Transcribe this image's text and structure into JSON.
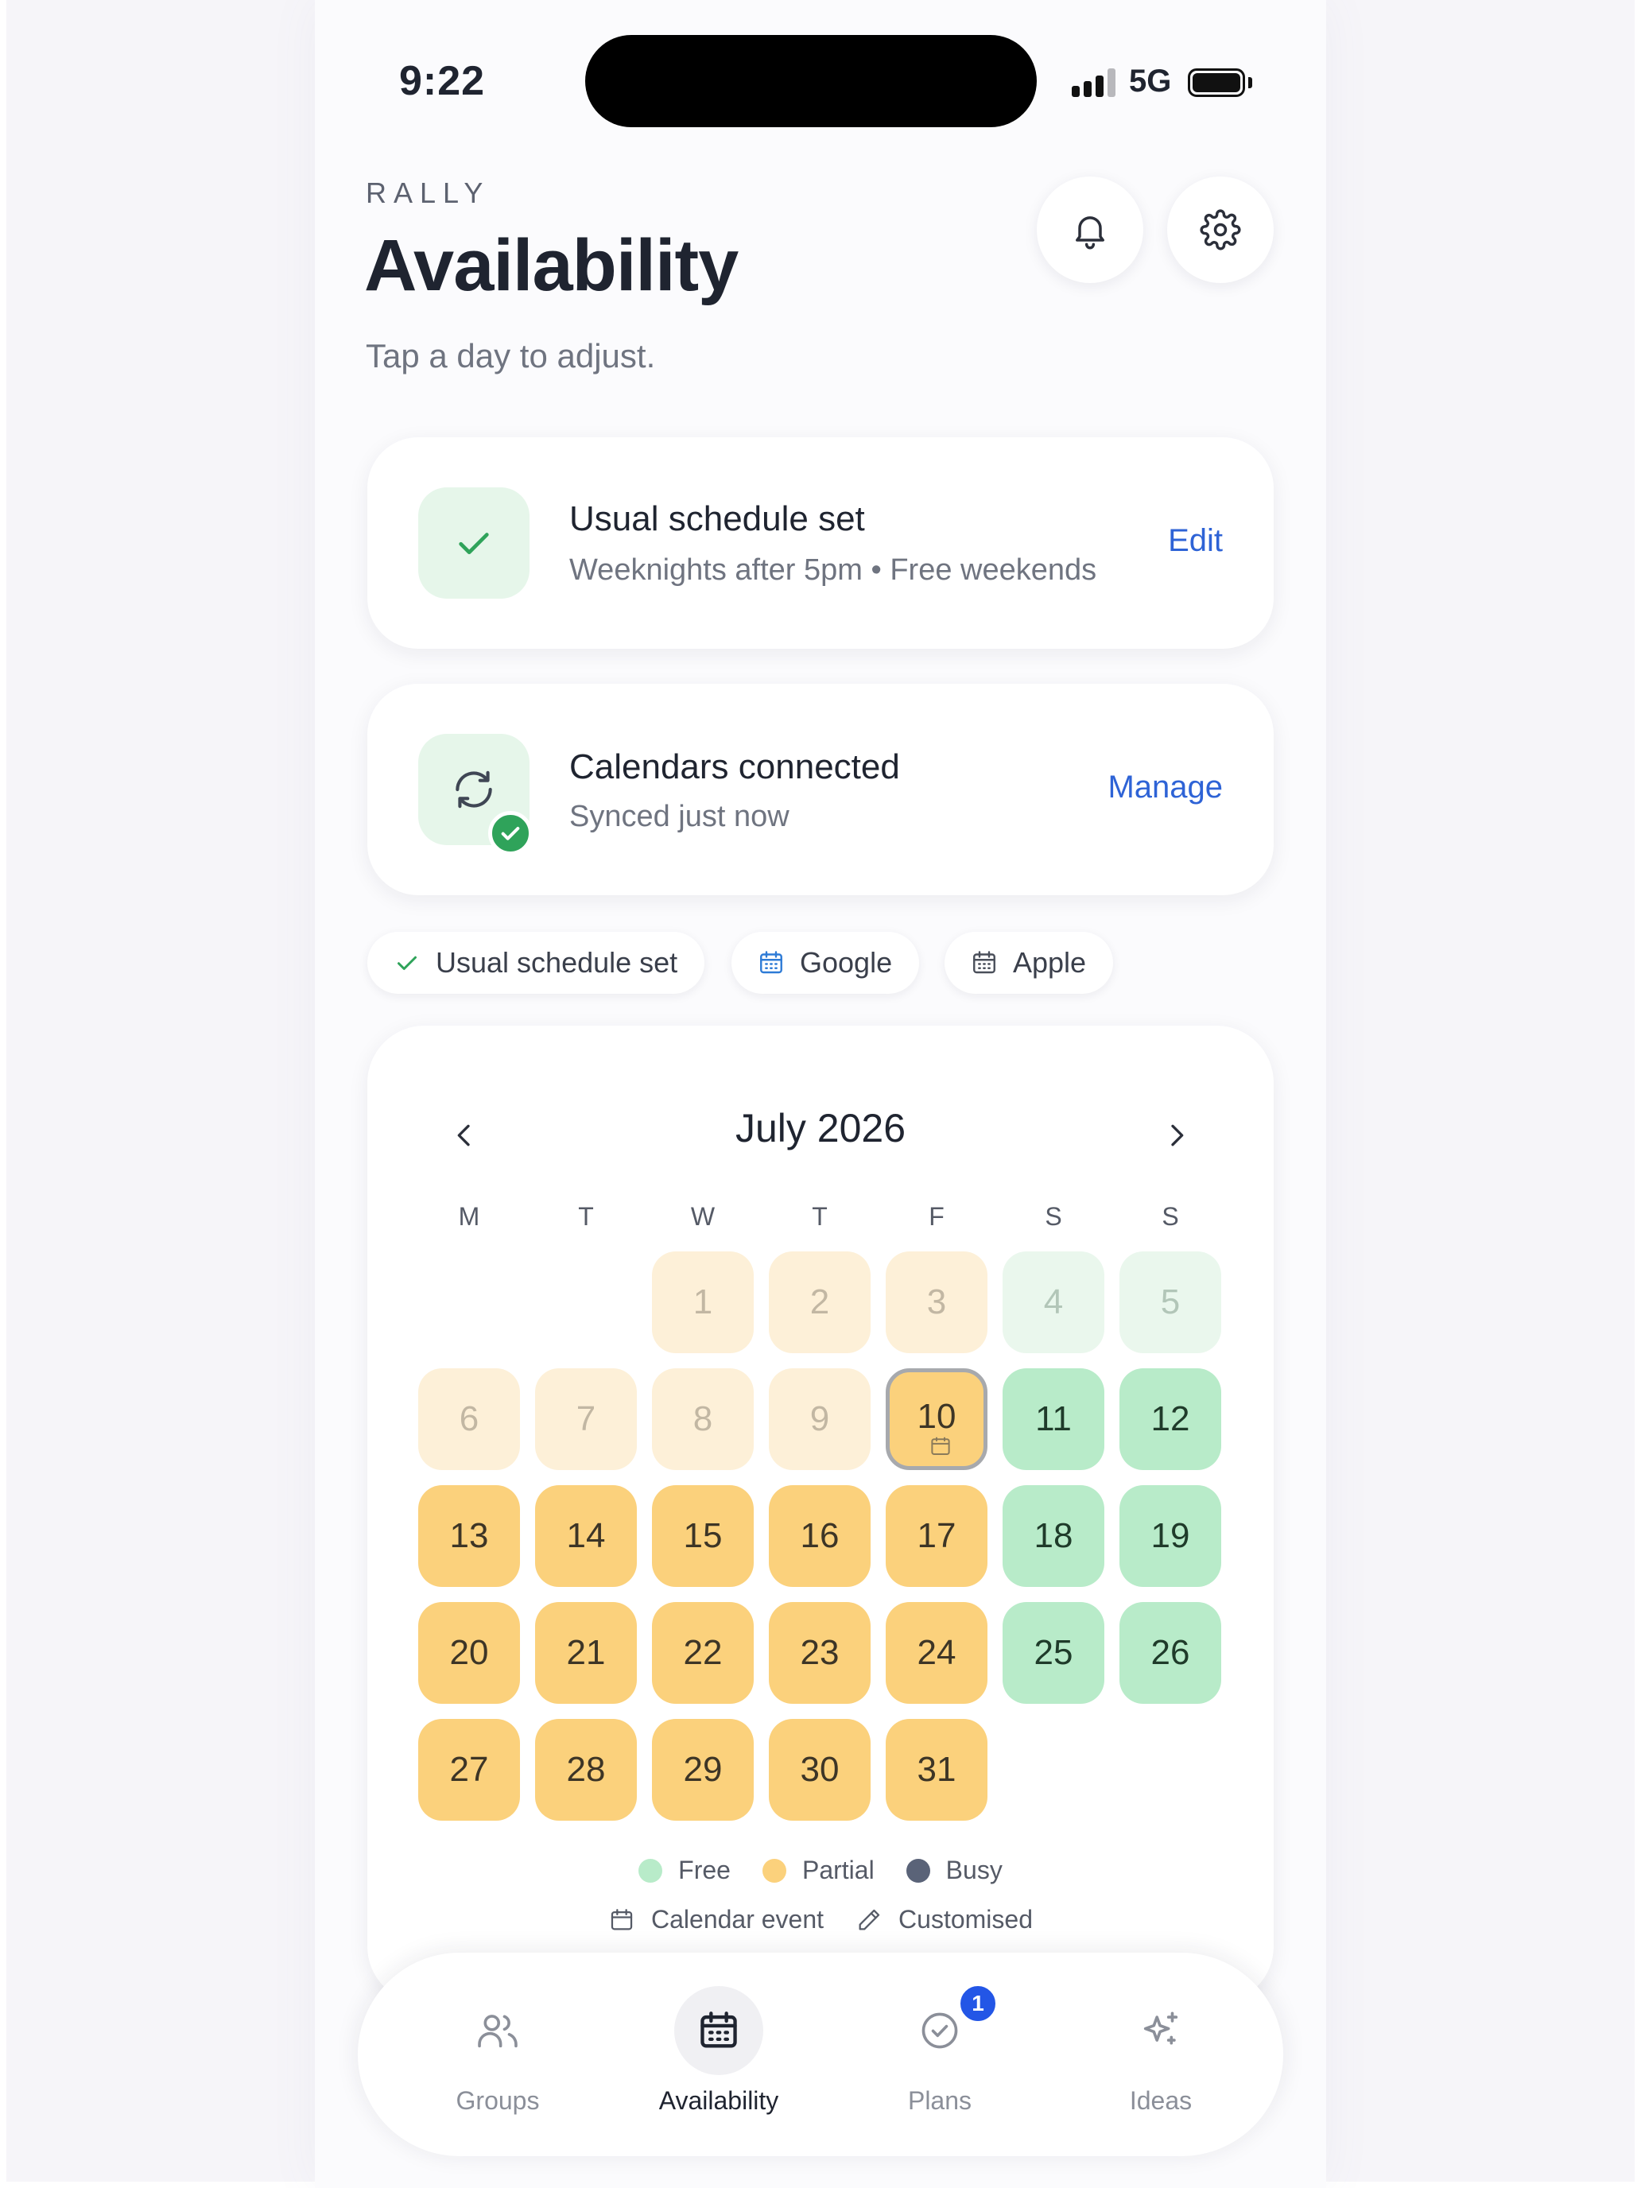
{
  "status_bar": {
    "time": "9:22",
    "network": "5G"
  },
  "header": {
    "brand": "RALLY",
    "title": "Availability",
    "subtitle": "Tap a day to adjust.",
    "notifications_icon": "bell-icon",
    "settings_icon": "gear-icon"
  },
  "schedule_card": {
    "title": "Usual schedule set",
    "subtitle": "Weeknights after 5pm • Free weekends",
    "action": "Edit",
    "icon": "check-icon"
  },
  "calendars_card": {
    "title": "Calendars connected",
    "subtitle": "Synced just now",
    "action": "Manage",
    "icon": "sync-icon"
  },
  "chips": [
    {
      "label": "Usual schedule set",
      "icon": "check-icon"
    },
    {
      "label": "Google",
      "icon": "calendar-icon"
    },
    {
      "label": "Apple",
      "icon": "calendar-icon"
    }
  ],
  "calendar": {
    "month": "July 2026",
    "weekdays": [
      "M",
      "T",
      "W",
      "T",
      "F",
      "S",
      "S"
    ],
    "days": [
      {
        "label": "1",
        "status": "partial",
        "past": true
      },
      {
        "label": "2",
        "status": "partial",
        "past": true
      },
      {
        "label": "3",
        "status": "partial",
        "past": true
      },
      {
        "label": "4",
        "status": "free",
        "past": true
      },
      {
        "label": "5",
        "status": "free",
        "past": true
      },
      {
        "label": "6",
        "status": "partial",
        "past": true
      },
      {
        "label": "7",
        "status": "partial",
        "past": true
      },
      {
        "label": "8",
        "status": "partial",
        "past": true
      },
      {
        "label": "9",
        "status": "partial",
        "past": true
      },
      {
        "label": "10",
        "status": "partial",
        "today": true,
        "calendar_event": true
      },
      {
        "label": "11",
        "status": "free"
      },
      {
        "label": "12",
        "status": "free"
      },
      {
        "label": "13",
        "status": "partial"
      },
      {
        "label": "14",
        "status": "partial"
      },
      {
        "label": "15",
        "status": "partial"
      },
      {
        "label": "16",
        "status": "partial"
      },
      {
        "label": "17",
        "status": "partial"
      },
      {
        "label": "18",
        "status": "free"
      },
      {
        "label": "19",
        "status": "free"
      },
      {
        "label": "20",
        "status": "partial"
      },
      {
        "label": "21",
        "status": "partial"
      },
      {
        "label": "22",
        "status": "partial"
      },
      {
        "label": "23",
        "status": "partial"
      },
      {
        "label": "24",
        "status": "partial"
      },
      {
        "label": "25",
        "status": "free"
      },
      {
        "label": "26",
        "status": "free"
      },
      {
        "label": "27",
        "status": "partial"
      },
      {
        "label": "28",
        "status": "partial"
      },
      {
        "label": "29",
        "status": "partial"
      },
      {
        "label": "30",
        "status": "partial"
      },
      {
        "label": "31",
        "status": "partial"
      }
    ],
    "legend": {
      "free": "Free",
      "partial": "Partial",
      "busy": "Busy",
      "calendar_event": "Calendar event",
      "customised": "Customised"
    },
    "colors": {
      "free": "#b8ebc9",
      "partial": "#fbd17c",
      "busy": "#5a6378"
    }
  },
  "tabbar": {
    "tabs": [
      {
        "label": "Groups",
        "icon": "users-icon"
      },
      {
        "label": "Availability",
        "icon": "calendar-icon",
        "active": true
      },
      {
        "label": "Plans",
        "icon": "check-circle-icon",
        "badge": "1"
      },
      {
        "label": "Ideas",
        "icon": "sparkles-icon"
      }
    ]
  },
  "accent_color": "#2e63d6"
}
